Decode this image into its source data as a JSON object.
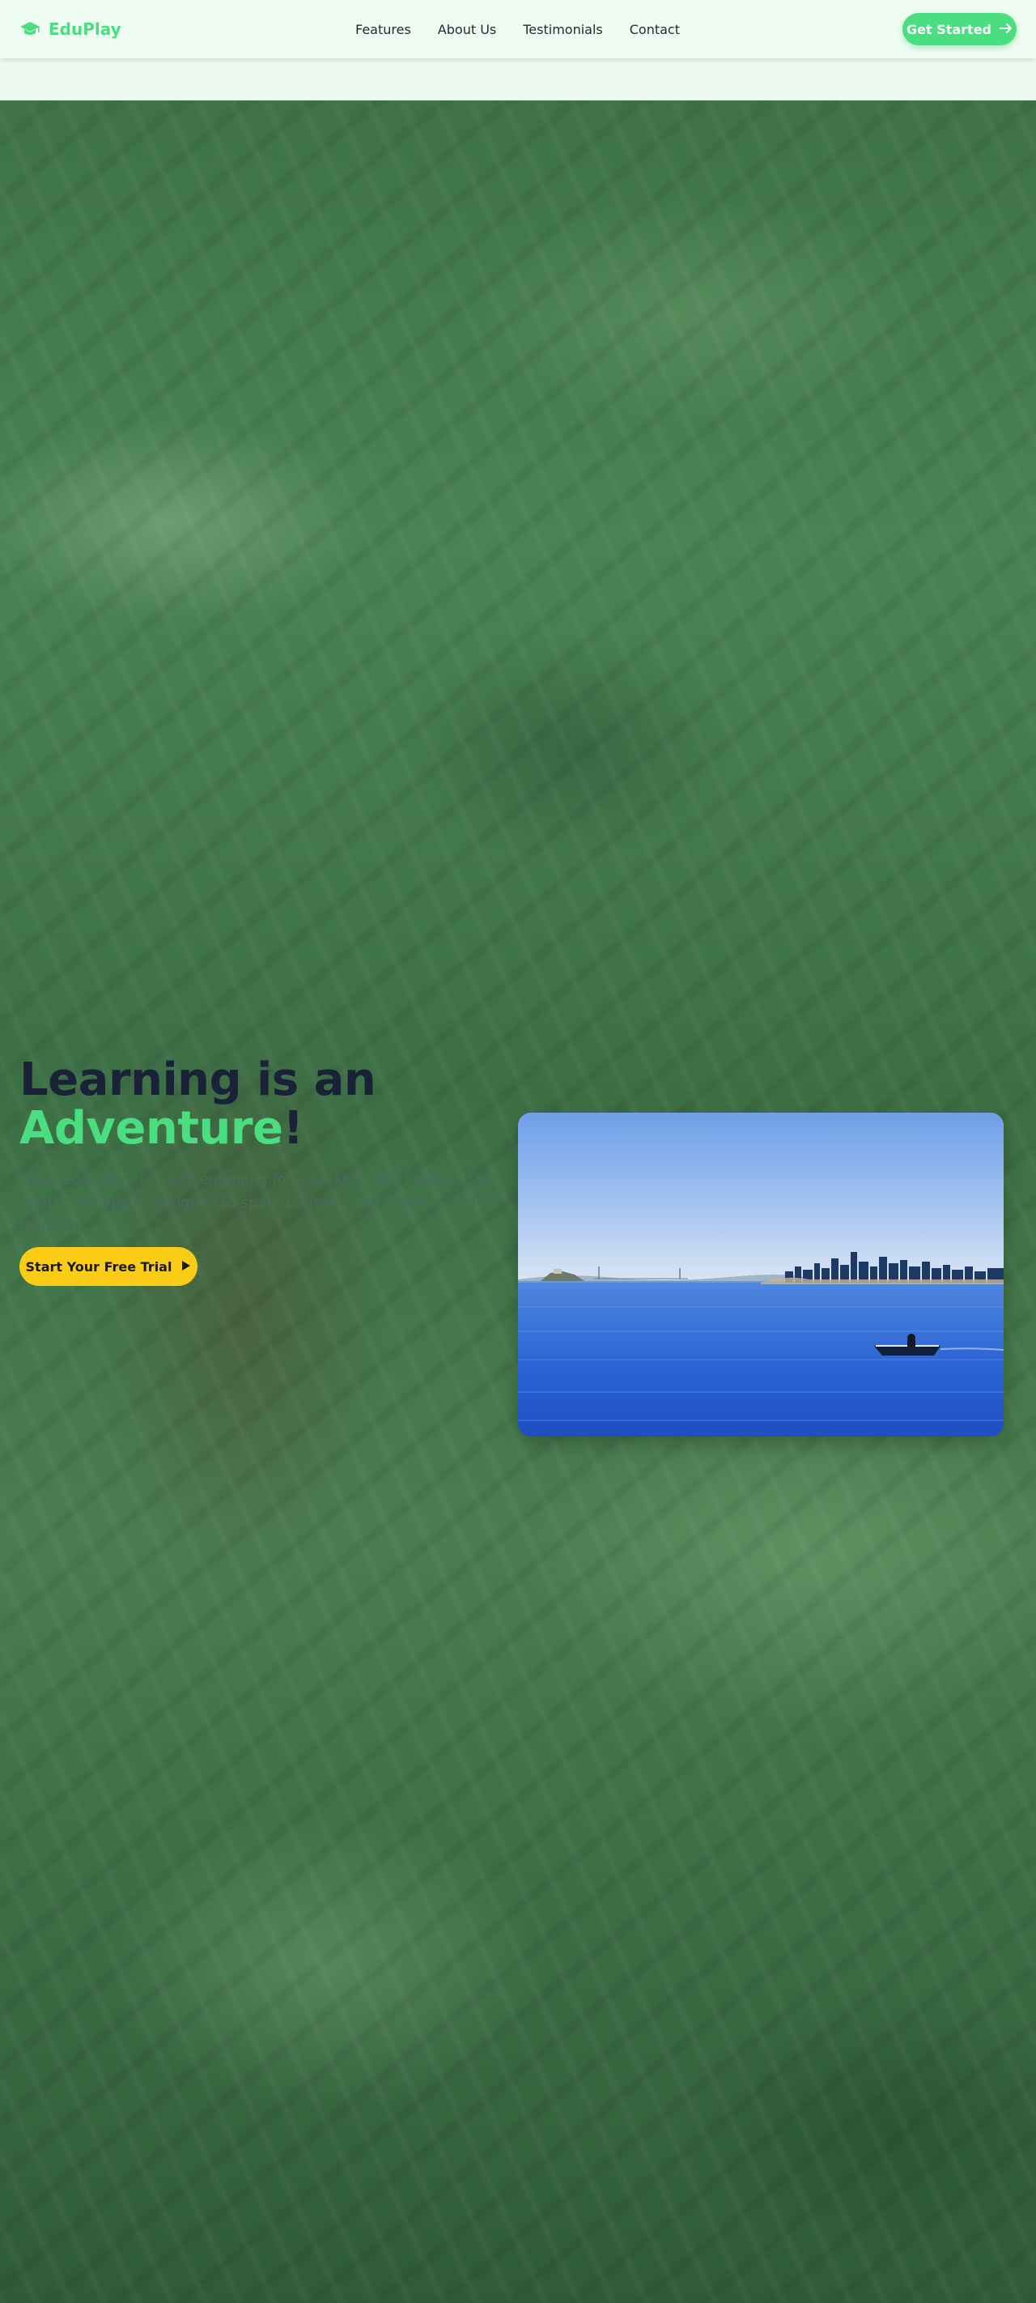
{
  "header": {
    "brand_name": "EduPlay",
    "brand_icon": "graduation-cap-icon",
    "nav": [
      {
        "label": "Features"
      },
      {
        "label": "About Us"
      },
      {
        "label": "Testimonials"
      },
      {
        "label": "Contact"
      }
    ],
    "cta_label": "Get Started",
    "cta_icon": "arrow-right-icon"
  },
  "hero": {
    "headline_line1": "Learning is an",
    "headline_accent": "Adventure",
    "headline_end": "!",
    "subtext": "Make education fun and engaging for your kids with EduPlay. Our interactive app is designed to spark curiosity and foster a love for learning.",
    "button_label": "Start Your Free Trial",
    "button_icon": "play-icon",
    "image_subject": "san-francisco-bay-boat-photo"
  },
  "colors": {
    "brand": "#4ade80",
    "button_yellow": "#facc15",
    "headline": "#1a2238"
  }
}
